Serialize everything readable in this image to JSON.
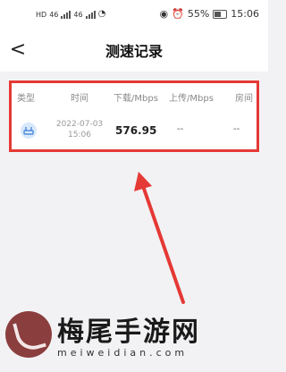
{
  "status_bar": {
    "left_labels": [
      "HD",
      "46",
      "46"
    ],
    "battery": "55%",
    "time": "15:06"
  },
  "header": {
    "back_symbol": "<",
    "title": "测速记录"
  },
  "table": {
    "columns": [
      "类型",
      "时间",
      "下载/Mbps",
      "上传/Mbps",
      "房间"
    ],
    "rows": [
      {
        "type_icon": "router-icon",
        "date": "2022-07-03",
        "time": "15:06",
        "download": "576.95",
        "upload": "--",
        "room": "--"
      }
    ]
  },
  "watermark": {
    "text": "梅尾手游网",
    "url": "meiweidian.com"
  },
  "colors": {
    "highlight_border": "#e53935",
    "arrow": "#e53935",
    "icon_bg": "#d7e9fb"
  }
}
